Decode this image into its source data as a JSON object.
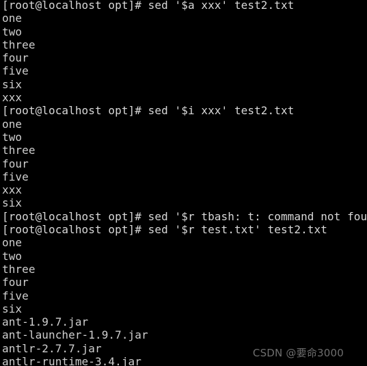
{
  "terminal": {
    "background_color": "#000000",
    "text_color": "#d4d4d4",
    "lines": [
      {
        "kind": "prompt",
        "text": "[root@localhost opt]# sed '$a xxx' test2.txt"
      },
      {
        "kind": "output",
        "text": "one"
      },
      {
        "kind": "output",
        "text": "two"
      },
      {
        "kind": "output",
        "text": "three"
      },
      {
        "kind": "output",
        "text": "four"
      },
      {
        "kind": "output",
        "text": "five"
      },
      {
        "kind": "output",
        "text": "six"
      },
      {
        "kind": "output",
        "text": "xxx"
      },
      {
        "kind": "prompt",
        "text": "[root@localhost opt]# sed '$i xxx' test2.txt"
      },
      {
        "kind": "output",
        "text": "one"
      },
      {
        "kind": "output",
        "text": "two"
      },
      {
        "kind": "output",
        "text": "three"
      },
      {
        "kind": "output",
        "text": "four"
      },
      {
        "kind": "output",
        "text": "five"
      },
      {
        "kind": "output",
        "text": "xxx"
      },
      {
        "kind": "output",
        "text": "six"
      },
      {
        "kind": "error",
        "text": "[root@localhost opt]# sed '$r tbash: t: command not found"
      },
      {
        "kind": "prompt",
        "text": "[root@localhost opt]# sed '$r test.txt' test2.txt"
      },
      {
        "kind": "output",
        "text": "one"
      },
      {
        "kind": "output",
        "text": "two"
      },
      {
        "kind": "output",
        "text": "three"
      },
      {
        "kind": "output",
        "text": "four"
      },
      {
        "kind": "output",
        "text": "five"
      },
      {
        "kind": "output",
        "text": "six"
      },
      {
        "kind": "output",
        "text": "ant-1.9.7.jar"
      },
      {
        "kind": "output",
        "text": "ant-launcher-1.9.7.jar"
      },
      {
        "kind": "output",
        "text": "antlr-2.7.7.jar"
      },
      {
        "kind": "output",
        "text": "antlr-runtime-3.4.jar"
      }
    ]
  },
  "watermark": {
    "text": "CSDN @要命3000",
    "color": "#6e6e6e"
  }
}
